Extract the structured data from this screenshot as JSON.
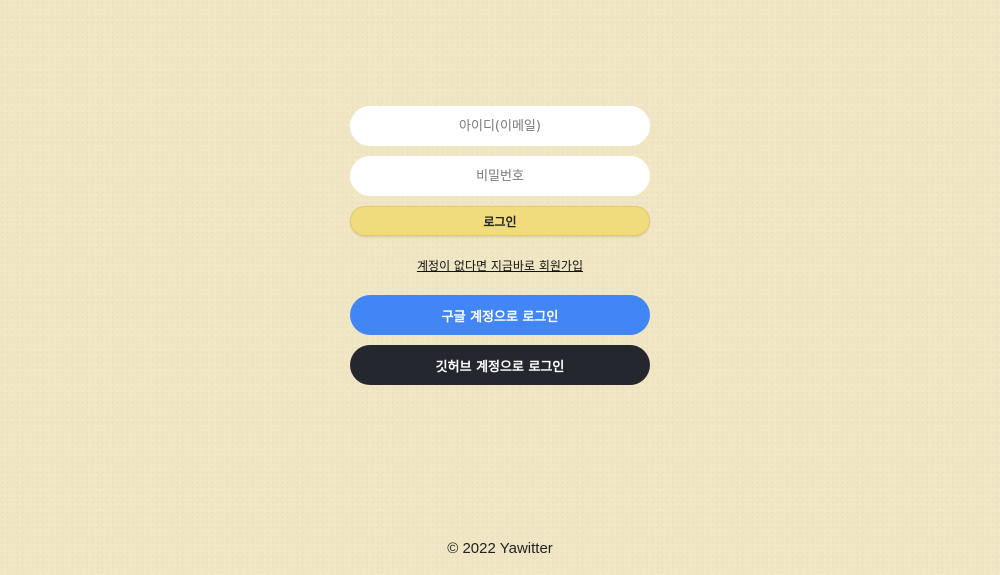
{
  "form": {
    "email_placeholder": "아이디(이메일)",
    "password_placeholder": "비밀번호",
    "login_label": "로그인",
    "signup_link": "계정이 없다면 지금바로 회원가입"
  },
  "social": {
    "google_label": "구글 계정으로 로그인",
    "github_label": "깃허브 계정으로 로그인"
  },
  "footer": {
    "copyright": "© 2022 Yawitter"
  },
  "colors": {
    "background": "#f1e6c4",
    "login_button": "#f0db7d",
    "google_button": "#4285f4",
    "github_button": "#24282e"
  }
}
